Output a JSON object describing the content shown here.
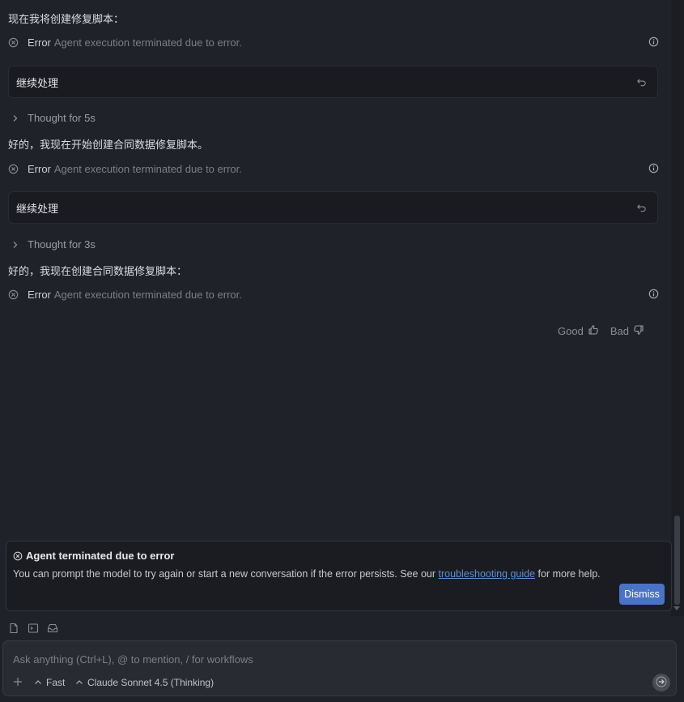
{
  "conversation": {
    "messages": [
      {
        "type": "assistant_text",
        "text": "现在我将创建修复脚本："
      },
      {
        "type": "error",
        "label": "Error",
        "message": "Agent execution terminated due to error."
      },
      {
        "type": "user",
        "text": "继续处理"
      },
      {
        "type": "thought",
        "text": "Thought for 5s"
      },
      {
        "type": "assistant_text",
        "text": "好的，我现在开始创建合同数据修复脚本。"
      },
      {
        "type": "error",
        "label": "Error",
        "message": "Agent execution terminated due to error."
      },
      {
        "type": "user",
        "text": "继续处理"
      },
      {
        "type": "thought",
        "text": "Thought for 3s"
      },
      {
        "type": "assistant_text",
        "text": "好的，我现在创建合同数据修复脚本："
      },
      {
        "type": "error",
        "label": "Error",
        "message": "Agent execution terminated due to error."
      }
    ],
    "feedback": {
      "good": "Good",
      "bad": "Bad"
    }
  },
  "error_panel": {
    "title": "Agent terminated due to error",
    "body_prefix": "You can prompt the model to try again or start a new conversation if the error persists. See our ",
    "link_text": "troubleshooting guide",
    "body_suffix": " for more help.",
    "dismiss_label": "Dismiss"
  },
  "composer": {
    "placeholder": "Ask anything (Ctrl+L), @ to mention, / for workflows",
    "mode_label": "Fast",
    "model_label": "Claude Sonnet 4.5 (Thinking)",
    "context_icons": [
      "file-icon",
      "terminal-icon",
      "inbox-icon"
    ]
  },
  "colors": {
    "background": "#202229",
    "accent": "#4a73c6",
    "link": "#5b8fd6"
  }
}
